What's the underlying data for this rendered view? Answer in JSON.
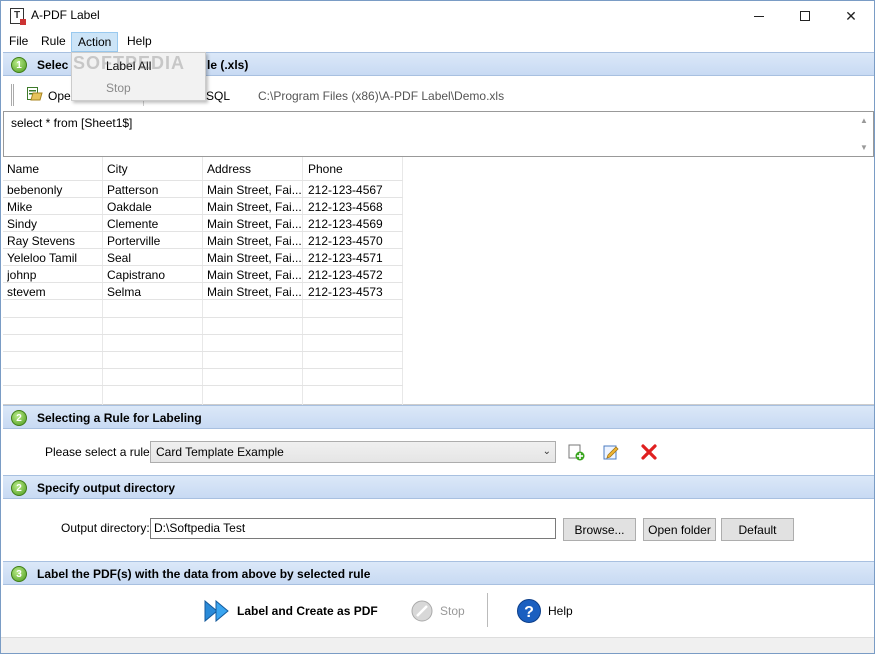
{
  "window": {
    "title": "A-PDF Label"
  },
  "menubar": {
    "items": [
      {
        "label": "File"
      },
      {
        "label": "Rule"
      },
      {
        "label": "Action"
      },
      {
        "label": "Help"
      }
    ]
  },
  "action_menu": {
    "items": [
      {
        "label": "Label All",
        "enabled": true
      },
      {
        "label": "Stop",
        "enabled": false
      }
    ]
  },
  "watermark": "SOFTPEDIA",
  "section1": {
    "number": "1",
    "title_visible": "Selec",
    "title_tail": "le (.xls)",
    "open_label": "Ope",
    "sql_label": "SQL",
    "path": "C:\\Program Files (x86)\\A-PDF Label\\Demo.xls",
    "sql_text": "select * from [Sheet1$]"
  },
  "grid": {
    "columns": [
      "Name",
      "City",
      "Address",
      "Phone"
    ],
    "rows": [
      [
        "bebenonly",
        "Patterson",
        "Main Street, Fai...",
        "212-123-4567"
      ],
      [
        "Mike",
        "Oakdale",
        "Main Street, Fai...",
        "212-123-4568"
      ],
      [
        "Sindy",
        "Clemente",
        "Main Street, Fai...",
        "212-123-4569"
      ],
      [
        "Ray Stevens",
        "Porterville",
        "Main Street, Fai...",
        "212-123-4570"
      ],
      [
        "Yeleloo Tamil",
        "Seal",
        "Main Street, Fai...",
        "212-123-4571"
      ],
      [
        "johnp",
        "Capistrano",
        "Main Street, Fai...",
        "212-123-4572"
      ],
      [
        "stevem",
        "Selma",
        "Main Street, Fai...",
        "212-123-4573"
      ]
    ]
  },
  "section2": {
    "number": "2",
    "title": "Selecting a Rule for Labeling",
    "prompt": "Please select a rule:",
    "selected_rule": "Card Template Example"
  },
  "section3": {
    "number": "2",
    "title": "Specify output directory",
    "label": "Output directory:",
    "value": "D:\\Softpedia Test",
    "browse": "Browse...",
    "open_folder": "Open folder",
    "default": "Default"
  },
  "section4": {
    "number": "3",
    "title": "Label the PDF(s) with the data from above by selected rule",
    "label_btn": "Label and Create as PDF",
    "stop_btn": "Stop",
    "help_btn": "Help"
  },
  "colors": {
    "header_gradient_top": "#dbe8f8",
    "header_gradient_bottom": "#c8daf3",
    "step_green": "#4c9a1c",
    "menu_highlight": "#cce4f7",
    "delete_red": "#e02020",
    "help_blue": "#1a5fc0"
  }
}
